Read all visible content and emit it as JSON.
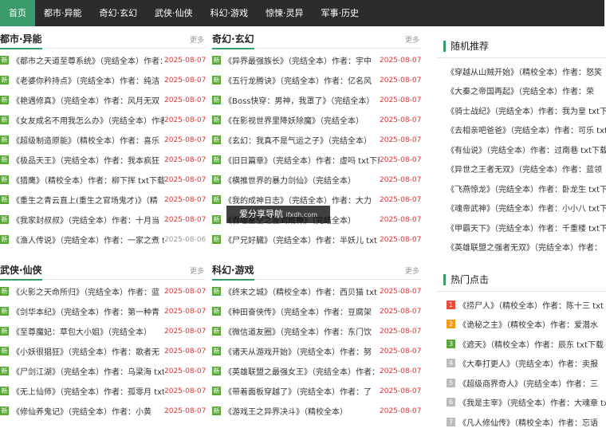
{
  "nav": {
    "items": [
      "首页",
      "都市·异能",
      "奇幻·玄幻",
      "武侠·仙侠",
      "科幻·游戏",
      "惊悚·灵异",
      "军事·历史"
    ],
    "active_color": "#3a9a6b"
  },
  "more_label": "更多",
  "sections": [
    {
      "title": "都市·异能",
      "rows": [
        {
          "text": "《都市之天道至尊系统》（完结全本）作者：尊天下",
          "date": "2025-08-07"
        },
        {
          "text": "《老婆你矜持点》（完结全本）作者：纯洁",
          "date": "2025-08-07"
        },
        {
          "text": "《艳遇修真》（完结全本）作者：风月无双",
          "date": "2025-08-07"
        },
        {
          "text": "《女友成名不用我怎么办》（完结全本）作者：",
          "date": "2025-08-07"
        },
        {
          "text": "《超级制造原能》（精校全本）作者：喜乐",
          "date": "2025-08-07"
        },
        {
          "text": "《极品天王》（完结全本）作者：我本疯狂",
          "date": "2025-08-07"
        },
        {
          "text": "《猎鹰》（精校全本）作者：柳下挥 txt下载",
          "date": "2025-08-07"
        },
        {
          "text": "《重生之青云直上(重生之官场鬼才)》（精",
          "date": "2025-08-07"
        },
        {
          "text": "《我家封叔叔》（完结全本）作者：十月当",
          "date": "2025-08-07"
        },
        {
          "text": "《渔人传说》（完结全本）作者：一家之煮 txt",
          "date": "2025-08-06"
        }
      ]
    },
    {
      "title": "奇幻·玄幻",
      "rows": [
        {
          "text": "《异界最强族长》（完结全本）作者：宇中",
          "date": "2025-08-07"
        },
        {
          "text": "《五行龙腾诀》（完结全本）作者：亿名风",
          "date": "2025-08-07"
        },
        {
          "text": "《Boss快穿：男神，我罩了》（完结全本）",
          "date": "2025-08-07"
        },
        {
          "text": "《在影视世界里降妖除魔》（完结全本）",
          "date": "2025-08-07"
        },
        {
          "text": "《玄幻：我真不是气运之子》（完结全本）",
          "date": "2025-08-07"
        },
        {
          "text": "《旧日篇章》（完结全本）作者：虚吗 txt下载",
          "date": "2025-08-07"
        },
        {
          "text": "《横推世界的暴力剑仙》（完结全本）",
          "date": "2025-08-07"
        },
        {
          "text": "《我的成神日志》（完结全本）作者：大力",
          "date": "2025-08-07"
        },
        {
          "text": "《吞噬星空之签到成神》（完结全本）",
          "date": "2025-08-07"
        },
        {
          "text": "《尸兄好臓》（完结全本）作者：半妖儿 txt",
          "date": "2025-08-07"
        }
      ]
    },
    {
      "title": "武侠·仙侠",
      "rows": [
        {
          "text": "《火影之天命所归》（完结全本）作者：蓝",
          "date": "2025-08-07"
        },
        {
          "text": "《剑华本纪》（完结全本）作者：第一种青",
          "date": "2025-08-07"
        },
        {
          "text": "《至尊魔妃：草包大小姐》（完结全本）",
          "date": "2025-08-07"
        },
        {
          "text": "《小妖很猖狂》（完结全本）作者：歌者无",
          "date": "2025-08-07"
        },
        {
          "text": "《尸剑江湖》（完结全本）作者：乌梁海 txt",
          "date": "2025-08-07"
        },
        {
          "text": "《无上仙师》（完结全本）作者：孤零月 txt",
          "date": "2025-08-07"
        },
        {
          "text": "《修仙养鬼记》（完结全本）作者：小黄",
          "date": "2025-08-07"
        }
      ]
    },
    {
      "title": "科幻·游戏",
      "rows": [
        {
          "text": "《终末之城》（精校全本）作者：西贝猫 txt",
          "date": "2025-08-07"
        },
        {
          "text": "《种田奋侠传》（完结全本）作者：豆腐架",
          "date": "2025-08-07"
        },
        {
          "text": "《微信道友圈》（完结全本）作者：东门饮",
          "date": "2025-08-07"
        },
        {
          "text": "《诸天从游戏开始》（完结全本）作者：努",
          "date": "2025-08-07"
        },
        {
          "text": "《英雄联盟之最强女王》（完结全本）作者：",
          "date": "2025-08-07"
        },
        {
          "text": "《带着面板穿越了》（完结全本）作者：了",
          "date": "2025-08-07"
        },
        {
          "text": "《游戏王之异界决斗》（精校全本）",
          "date": "2025-08-07"
        }
      ]
    }
  ],
  "sidebar": {
    "random": {
      "title": "随机推荐",
      "rows": [
        "《穿越从山贼开始》（精校全本）作者：怒笑",
        "《大秦之帝国再起》（完结全本）作者：荣",
        "《骑士战纪》（完结全本）作者：我为皇 txt下",
        "《去相亲吧爸爸》（完结全本）作者：可乐 txt",
        "《有仙说》（完结全本）作者：过南巷 txt下载",
        "《异世之王者无双》（完结全本）作者：蓝领",
        "《飞燕惊龙》（完结全本）作者：卧龙生 txt下",
        "《魂帝武神》（完结全本）作者：小小八 txt下",
        "《甲霸天下》（完结全本）作者：千重楼 txt下",
        "《英雄联盟之强者无双》（完结全本）作者："
      ]
    },
    "hot": {
      "title": "热门点击",
      "rows": [
        {
          "num": "1",
          "color": "#e74c3c",
          "text": "《捞尸人》（精校全本）作者：陈十三 txt"
        },
        {
          "num": "2",
          "color": "#f39c12",
          "text": "《诡秘之主》（精校全本）作者：爱潜水"
        },
        {
          "num": "3",
          "color": "#5aa937",
          "text": "《遮天》（精校全本）作者：辰东 txt下载"
        },
        {
          "num": "4",
          "color": "#bbbbbb",
          "text": "《大奉打更人》（完结全本）作者：卖报"
        },
        {
          "num": "5",
          "color": "#bbbbbb",
          "text": "《超级商界奇人》（完结全本）作者：三"
        },
        {
          "num": "6",
          "color": "#bbbbbb",
          "text": "《我是主宰》（完结全本）作者：大魂章 txt"
        },
        {
          "num": "7",
          "color": "#bbbbbb",
          "text": "《凡人修仙传》（精校全本）作者：忘语"
        }
      ]
    }
  },
  "tag_label": "新",
  "watermark": {
    "main": "爱分享导航",
    "site": "ifxdh.com"
  }
}
